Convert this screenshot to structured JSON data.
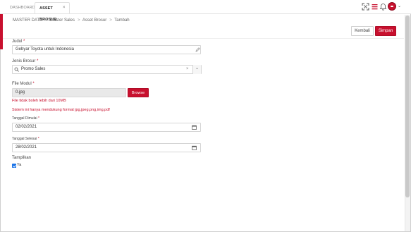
{
  "tabs": {
    "dashboard": "DASHBOARD",
    "asset": "ASSET BROSUR",
    "close": "×"
  },
  "header_icons": [
    "fullscreen-icon",
    "menu-icon",
    "bell-icon",
    "avatar",
    "chevron-down-icon"
  ],
  "breadcrumb": {
    "items": [
      "MASTER DATA",
      "Master Sales",
      "Asset Brosur",
      "Tambah"
    ],
    "separator": ">"
  },
  "actions": {
    "back_label": "Kembali",
    "save_label": "Simpan"
  },
  "form": {
    "judul": {
      "label": "Judul",
      "required_mark": "*",
      "value": "Gebyar Toyota untuk Indonesia"
    },
    "jenis": {
      "label": "Jenis Brosur",
      "required_mark": "*",
      "value": "Promo Sales",
      "clear": "×",
      "arrow": "⌄"
    },
    "file": {
      "label": "File Modul",
      "required_mark": "*",
      "value": "0.jpg",
      "browse_label": "Browse",
      "error_size": "File tidak boleh lebih dari 10MB",
      "error_format": "Sistem ini hanya mendukung format jpg,jpeg,png,img,pdf"
    },
    "tgl_dimulai": {
      "label": "Tanggal Dimulai",
      "required_mark": "*",
      "value": "02/02/2021"
    },
    "tgl_selesai": {
      "label": "Tanggal Selesai",
      "required_mark": "*",
      "value": "28/02/2021"
    },
    "tampilkan": {
      "label": "Tampilkan",
      "checkbox_label": "Ya",
      "checked": true
    }
  },
  "colors": {
    "brand": "#c8102e",
    "checkbox": "#1a73e8"
  }
}
